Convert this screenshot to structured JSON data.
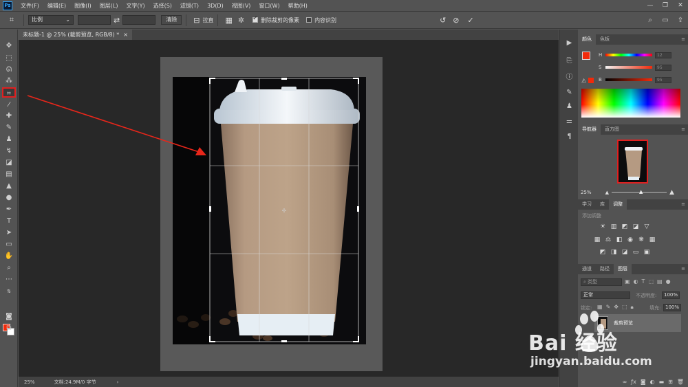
{
  "app": {
    "logo": "Ps",
    "menus": [
      "文件(F)",
      "编辑(E)",
      "图像(I)",
      "图层(L)",
      "文字(Y)",
      "选择(S)",
      "滤镜(T)",
      "3D(D)",
      "视图(V)",
      "窗口(W)",
      "帮助(H)"
    ]
  },
  "options": {
    "ratio_label": "比例",
    "clear_label": "清除",
    "straighten_label": "拉直",
    "delete_pixels_label": "删除裁剪的像素",
    "delete_pixels_checked": true,
    "content_aware_label": "内容识别",
    "content_aware_checked": false
  },
  "document": {
    "tab_title": "未标题-1 @ 25% (裁剪预览, RGB/8) *",
    "close": "×"
  },
  "status": {
    "zoom": "25%",
    "doc_info": "文档:24.9M/0 字节",
    "arrow": "›"
  },
  "panels": {
    "color": {
      "tabs": [
        "颜色",
        "色板"
      ],
      "rows": [
        {
          "label": "H",
          "value": "12"
        },
        {
          "label": "S",
          "value": "95"
        },
        {
          "label": "B",
          "value": "95"
        }
      ],
      "foreground_color": "#f22a0a",
      "background_color": "#ffffff"
    },
    "navigator": {
      "tabs": [
        "导航器",
        "直方图"
      ],
      "zoom": "25%"
    },
    "adjustments": {
      "tabs": [
        "学习",
        "库",
        "调整"
      ],
      "title": "添加调整"
    },
    "layers": {
      "tabs": [
        "通道",
        "路径",
        "图层"
      ],
      "search_placeholder": "类型",
      "blend_mode": "正常",
      "opacity_label": "不透明度:",
      "opacity_value": "100%",
      "lock_label": "锁定:",
      "fill_label": "填充:",
      "fill_value": "100%",
      "layer_name": "裁剪预览"
    }
  },
  "watermark": {
    "brand": "Bai 经验",
    "url": "jingyan.baidu.com"
  },
  "colors": {
    "accent_red": "#e02020",
    "panel_bg": "#535353",
    "canvas_bg": "#282828"
  }
}
